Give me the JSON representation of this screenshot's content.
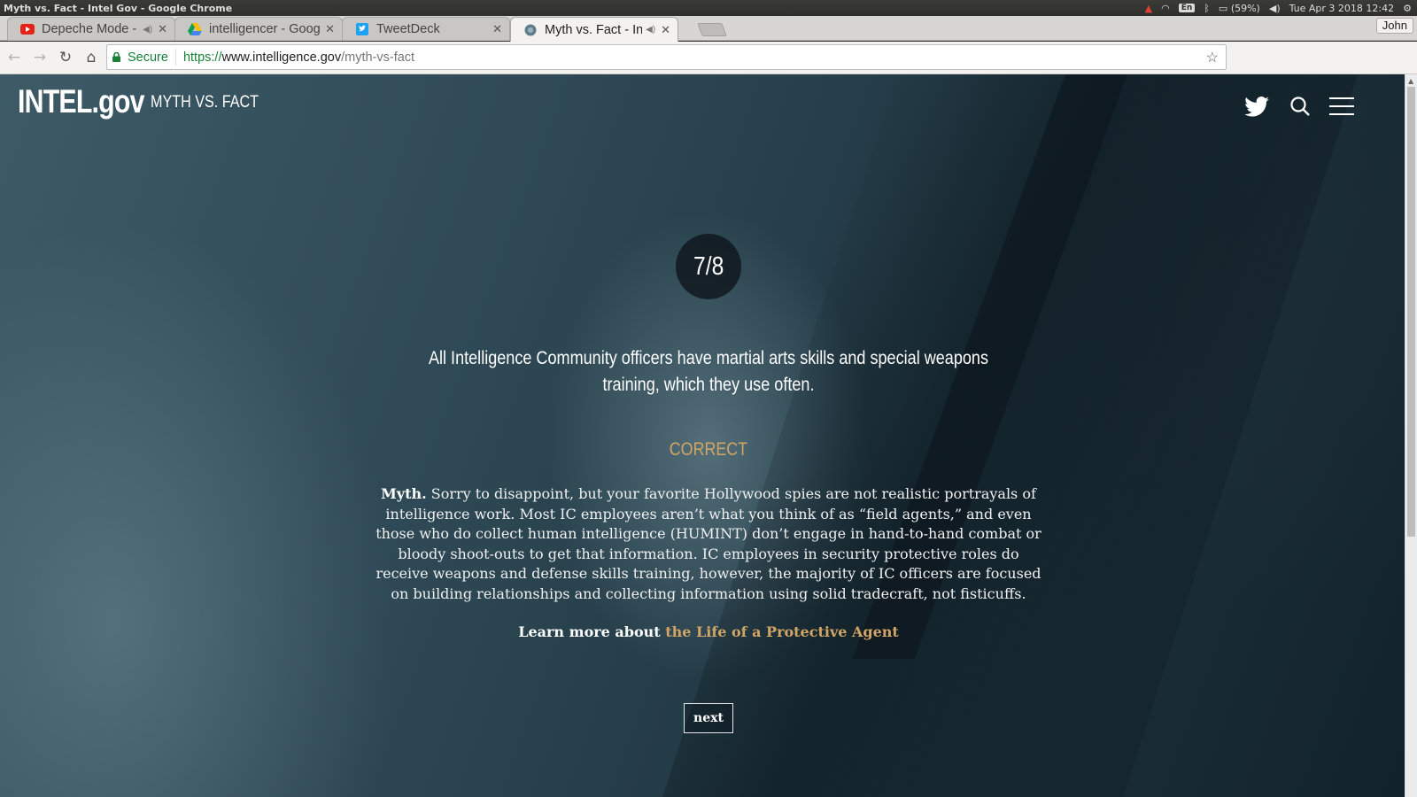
{
  "os": {
    "window_title": "Myth vs. Fact - Intel Gov - Google Chrome",
    "keyboard": "En",
    "battery": "(59%)",
    "datetime": "Tue Apr 3 2018 12:42"
  },
  "browser": {
    "tabs": [
      {
        "title": "Depeche Mode - (",
        "icon": "youtube-icon",
        "muted_icon": true,
        "active": false
      },
      {
        "title": "intelligencer - Goog",
        "icon": "google-drive-icon",
        "muted_icon": false,
        "active": false
      },
      {
        "title": "TweetDeck",
        "icon": "twitter-icon",
        "muted_icon": false,
        "active": false
      },
      {
        "title": "Myth vs. Fact - Int",
        "icon": "globe-icon",
        "muted_icon": true,
        "active": true
      }
    ],
    "profile_name": "John",
    "address": {
      "secure_label": "Secure",
      "scheme": "https://",
      "host": "www.intelligence.gov",
      "path": "/myth-vs-fact"
    }
  },
  "site": {
    "logo": "INTEL.gov",
    "section": "MYTH VS. FACT",
    "counter": "7/8",
    "statement": "All Intelligence Community officers have martial arts skills and special weapons training, which they use often.",
    "verdict": "CORRECT",
    "explanation_lead": "Myth.",
    "explanation_body": " Sorry to disappoint, but your favorite Hollywood spies are not realistic portrayals of intelligence work. Most IC employees aren’t what you think of as “field agents,” and even those who do collect human intelligence (HUMINT) don’t engage in hand-to-hand combat or bloody shoot-outs to get that information. IC employees in security protective roles do receive weapons and defense skills training, however, the majority of IC officers are focused on building relationships and collecting information using solid tradecraft, not fisticuffs.",
    "learn_prefix": "Learn more about ",
    "learn_link": "the Life of a Protective Agent",
    "next_label": "next"
  },
  "colors": {
    "accent": "#d1a565",
    "secure_green": "#188038"
  }
}
